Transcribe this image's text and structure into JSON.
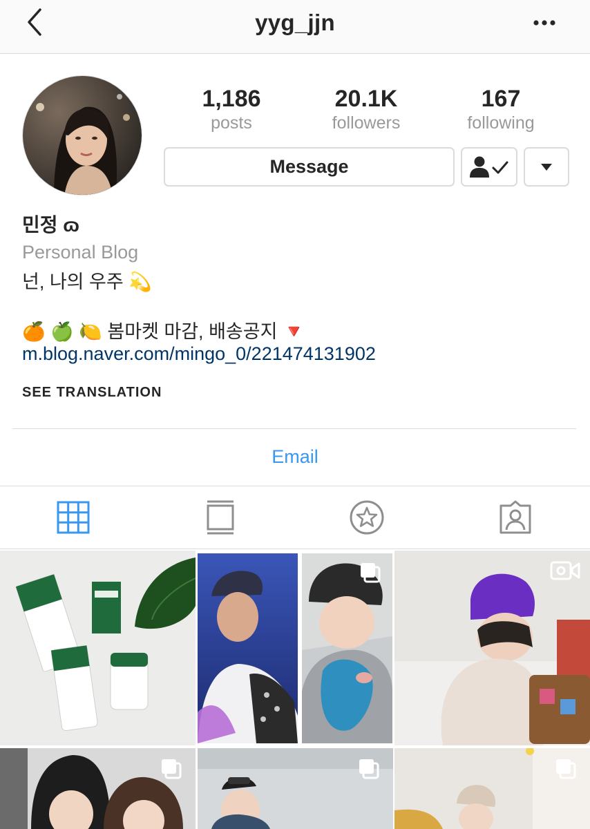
{
  "header": {
    "username": "yyg_jjn",
    "back_icon": "chevron-left-icon",
    "more_icon": "more-horizontal-icon"
  },
  "profile": {
    "stats": [
      {
        "value": "1,186",
        "label": "posts"
      },
      {
        "value": "20.1K",
        "label": "followers"
      },
      {
        "value": "167",
        "label": "following"
      }
    ],
    "message_label": "Message",
    "following_icon": "person-check-icon",
    "dropdown_icon": "caret-down-icon"
  },
  "bio": {
    "name": "민정 ɷ",
    "category": "Personal Blog",
    "line1": "넌, 나의 우주 💫",
    "line2": "🍊 🍏 🍋 봄마켓 마감, 배송공지 🔻",
    "link": "m.blog.naver.com/mingo_0/221474131902",
    "see_translation": "SEE TRANSLATION"
  },
  "contact": {
    "email_label": "Email"
  },
  "tabs": [
    {
      "icon": "grid-icon",
      "active": true
    },
    {
      "icon": "feed-list-icon",
      "active": false
    },
    {
      "icon": "star-circle-icon",
      "active": false
    },
    {
      "icon": "tagged-person-icon",
      "active": false
    }
  ],
  "colors": {
    "accent_blue": "#3897f0",
    "link_blue": "#003569",
    "muted_gray": "#999999",
    "border": "#dbdbdb",
    "text": "#262626"
  }
}
